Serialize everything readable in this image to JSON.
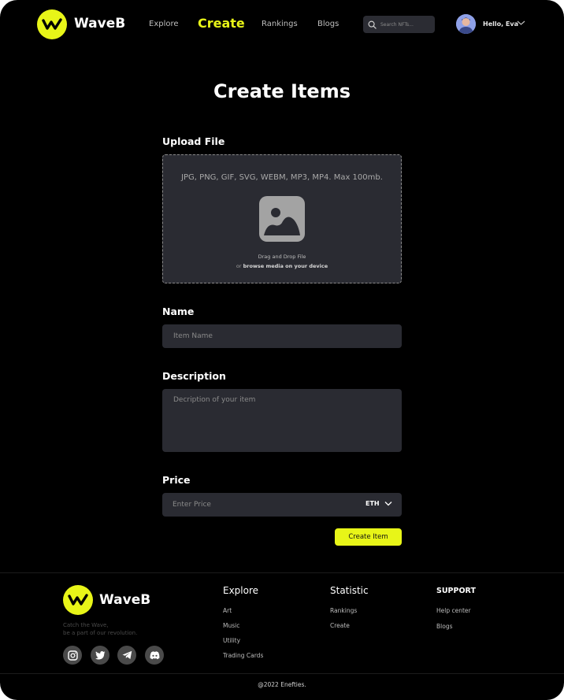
{
  "header": {
    "brand": "WaveB",
    "nav": [
      "Explore",
      "Create",
      "Rankings",
      "Blogs"
    ],
    "active_nav": "Create",
    "search_placeholder": "Search NFTs...",
    "greeting": "Hello, Eva"
  },
  "main": {
    "title": "Create Items",
    "upload": {
      "label": "Upload File",
      "types": "JPG, PNG, GIF, SVG, WEBM, MP3, MP4. Max 100mb.",
      "drag": "Drag and Drop File",
      "or": "or",
      "browse": "browse media on your device"
    },
    "name": {
      "label": "Name",
      "placeholder": "Item Name"
    },
    "description": {
      "label": "Description",
      "placeholder": "Decription of your item"
    },
    "price": {
      "label": "Price",
      "placeholder": "Enter Price",
      "currency": "ETH"
    },
    "submit": "Create Item"
  },
  "footer": {
    "brand": "WaveB",
    "tagline_1": "Catch the Wave,",
    "tagline_2": "be a part of our revolution.",
    "social": [
      "instagram-icon",
      "twitter-icon",
      "telegram-icon",
      "discord-icon"
    ],
    "columns": [
      {
        "title": "Explore",
        "links": [
          "Art",
          "Music",
          "Utility",
          "Trading Cards"
        ]
      },
      {
        "title": "Statistic",
        "links": [
          "Rankings",
          "Create"
        ]
      },
      {
        "title": "SUPPORT",
        "links": [
          "Help center",
          "Blogs"
        ]
      }
    ],
    "copyright": "@2022 Enefties."
  },
  "colors": {
    "accent": "#e8f518",
    "background": "#000000",
    "field": "#2a2b32"
  }
}
